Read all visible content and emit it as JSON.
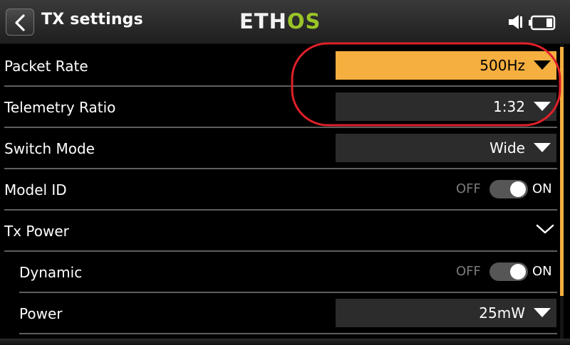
{
  "header": {
    "title": "TX settings",
    "logo_white": "ETH",
    "logo_green": "OS",
    "back_icon": "chevron-left-icon",
    "speaker_icon": "speaker-icon",
    "battery_icon": "battery-icon"
  },
  "rows": [
    {
      "label": "Packet Rate",
      "type": "dropdown",
      "value": "500Hz",
      "selected": true
    },
    {
      "label": "Telemetry Ratio",
      "type": "dropdown",
      "value": "1:32"
    },
    {
      "label": "Switch Mode",
      "type": "dropdown",
      "value": "Wide"
    },
    {
      "label": "Model ID",
      "type": "toggle",
      "off_label": "OFF",
      "on_label": "ON",
      "state": "on"
    },
    {
      "label": "Tx Power",
      "type": "expander",
      "icon": "chevron-down-icon",
      "expanded": true
    },
    {
      "label": "Dynamic",
      "type": "toggle",
      "off_label": "OFF",
      "on_label": "ON",
      "state": "on"
    },
    {
      "label": "Power",
      "type": "dropdown",
      "value": "25mW"
    }
  ],
  "colors": {
    "accent": "#f4af3f",
    "logo_green": "#9bc427",
    "annotation_red": "#e0202a",
    "dropdown_bg": "#2c2c2c"
  }
}
